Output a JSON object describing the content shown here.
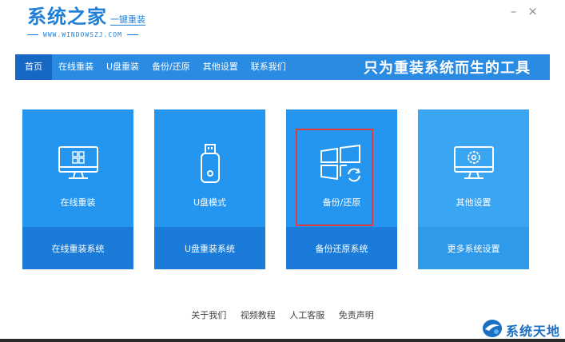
{
  "logo": {
    "title": "系统之家",
    "subtitle": "一键重装",
    "url": "WWW.WINDOWSZJ.COM"
  },
  "window_controls": {
    "minimize": "–",
    "close": "×"
  },
  "nav": {
    "items": [
      "首页",
      "在线重装",
      "U盘重装",
      "备份/还原",
      "其他设置",
      "联系我们"
    ],
    "active_index": 0,
    "slogan": "只为重装系统而生的工具"
  },
  "cards": [
    {
      "icon": "monitor-windows-icon",
      "label": "在线重装",
      "action": "在线重装系统"
    },
    {
      "icon": "usb-drive-icon",
      "label": "U盘模式",
      "action": "U盘重装系统"
    },
    {
      "icon": "windows-restore-icon",
      "label": "备份/还原",
      "action": "备份还原系统"
    },
    {
      "icon": "monitor-gear-icon",
      "label": "其他设置",
      "action": "更多系统设置"
    }
  ],
  "footer": {
    "links": [
      "关于我们",
      "视频教程",
      "人工客服",
      "免责声明"
    ]
  },
  "watermark": {
    "text": "系统天地"
  },
  "colors": {
    "brand": "#1f7fd6",
    "nav_bg": "#2a8be2",
    "nav_active": "#1767c4",
    "card_top": "#2496f0",
    "card_bottom": "#1a7cd8",
    "highlight": "#e03a3a"
  }
}
